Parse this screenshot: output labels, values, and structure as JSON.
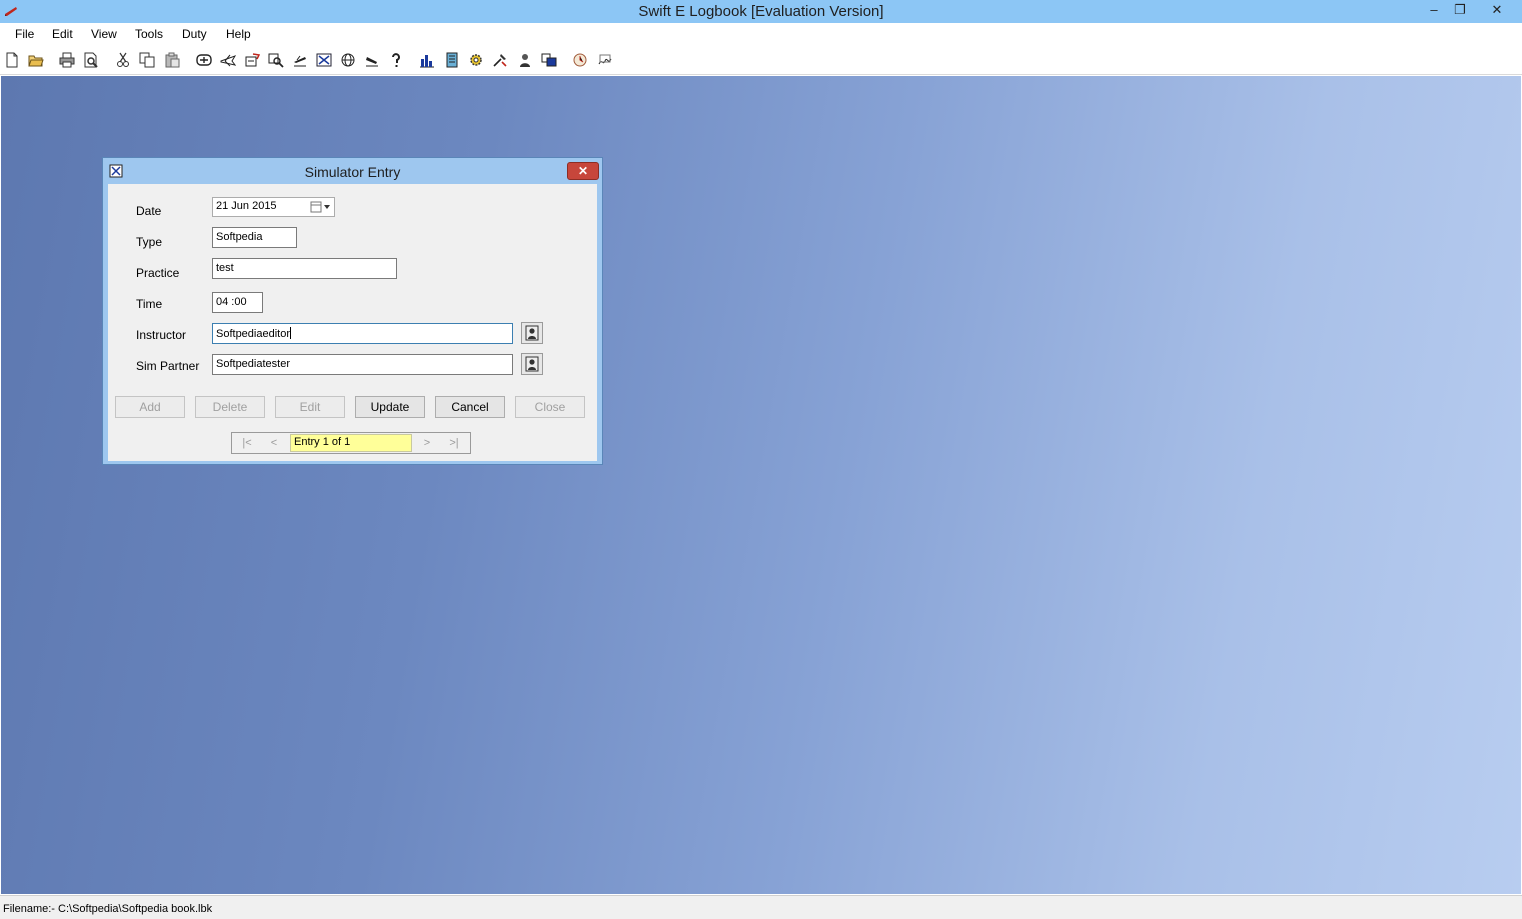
{
  "window": {
    "title": "Swift E Logbook [Evaluation Version]",
    "controls": {
      "minimize": "–",
      "maximize": "❐",
      "close": "✕"
    }
  },
  "menubar": [
    "File",
    "Edit",
    "View",
    "Tools",
    "Duty",
    "Help"
  ],
  "toolbar": {
    "icons": [
      "new-file-icon",
      "open-folder-icon",
      "print-icon",
      "print-preview-icon",
      "cut-icon",
      "copy-icon",
      "paste-icon",
      "flight-entry-icon",
      "aircraft-icon",
      "plane-edit-icon",
      "search-icon",
      "takeoff-icon",
      "navigation-icon",
      "globe-icon",
      "landing-icon",
      "help-icon",
      "bar-chart-icon",
      "report-icon",
      "settings-gear-icon",
      "tools-icon",
      "pilot-icon",
      "simulator-icon",
      "clock-icon",
      "signature-icon"
    ]
  },
  "dialog": {
    "title": "Simulator Entry",
    "close": "✕",
    "fields": {
      "date_label": "Date",
      "date_value": "21  Jun  2015",
      "type_label": "Type",
      "type_value": "Softpedia",
      "practice_label": "Practice",
      "practice_value": "test",
      "time_label": "Time",
      "time_value": "04 :00",
      "instructor_label": "Instructor",
      "instructor_value": "Softpediaeditor",
      "sim_partner_label": "Sim Partner",
      "sim_partner_value": "Softpediatester"
    },
    "buttons": {
      "add": "Add",
      "delete": "Delete",
      "edit": "Edit",
      "update": "Update",
      "cancel": "Cancel",
      "close": "Close"
    },
    "navigator": {
      "first": "|<",
      "prev": "<",
      "entry": "Entry 1 of 1",
      "next": ">",
      "last": ">|"
    }
  },
  "statusbar": {
    "filename": "Filename:- C:\\Softpedia\\Softpedia book.lbk"
  },
  "colors": {
    "titlebar": "#8cc6f5",
    "dialog_frame": "#9ec7ef",
    "nav_entry": "#ffff99",
    "close_button": "#c7463b"
  }
}
